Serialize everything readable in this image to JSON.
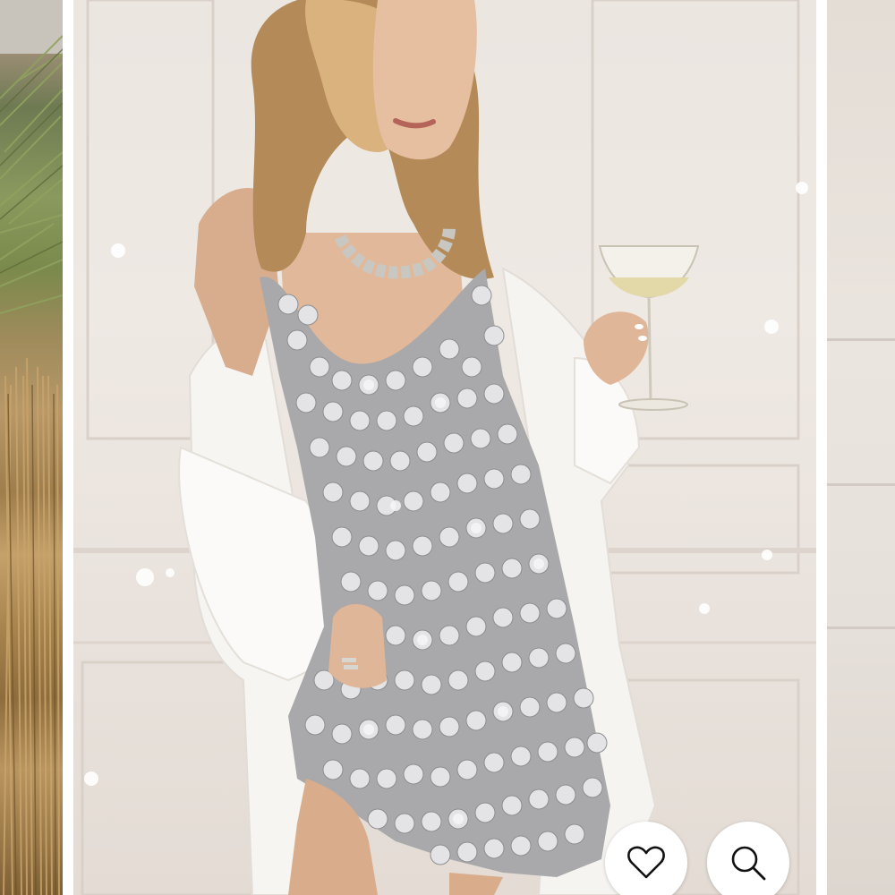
{
  "gallery": {
    "left_peek": {
      "icon": "desert-plant-photo"
    },
    "main_image": {
      "subject": "model-in-silver-disc-dress"
    },
    "right_peek": {
      "icon": "wall-panel-photo"
    }
  },
  "actions": {
    "wishlist": {
      "icon": "heart-icon",
      "color": "#111111"
    },
    "image_search": {
      "icon": "search-icon",
      "color": "#111111"
    }
  },
  "colors": {
    "background": "#ffffff",
    "button_bg": "#ffffff",
    "icon_stroke": "#111111"
  }
}
